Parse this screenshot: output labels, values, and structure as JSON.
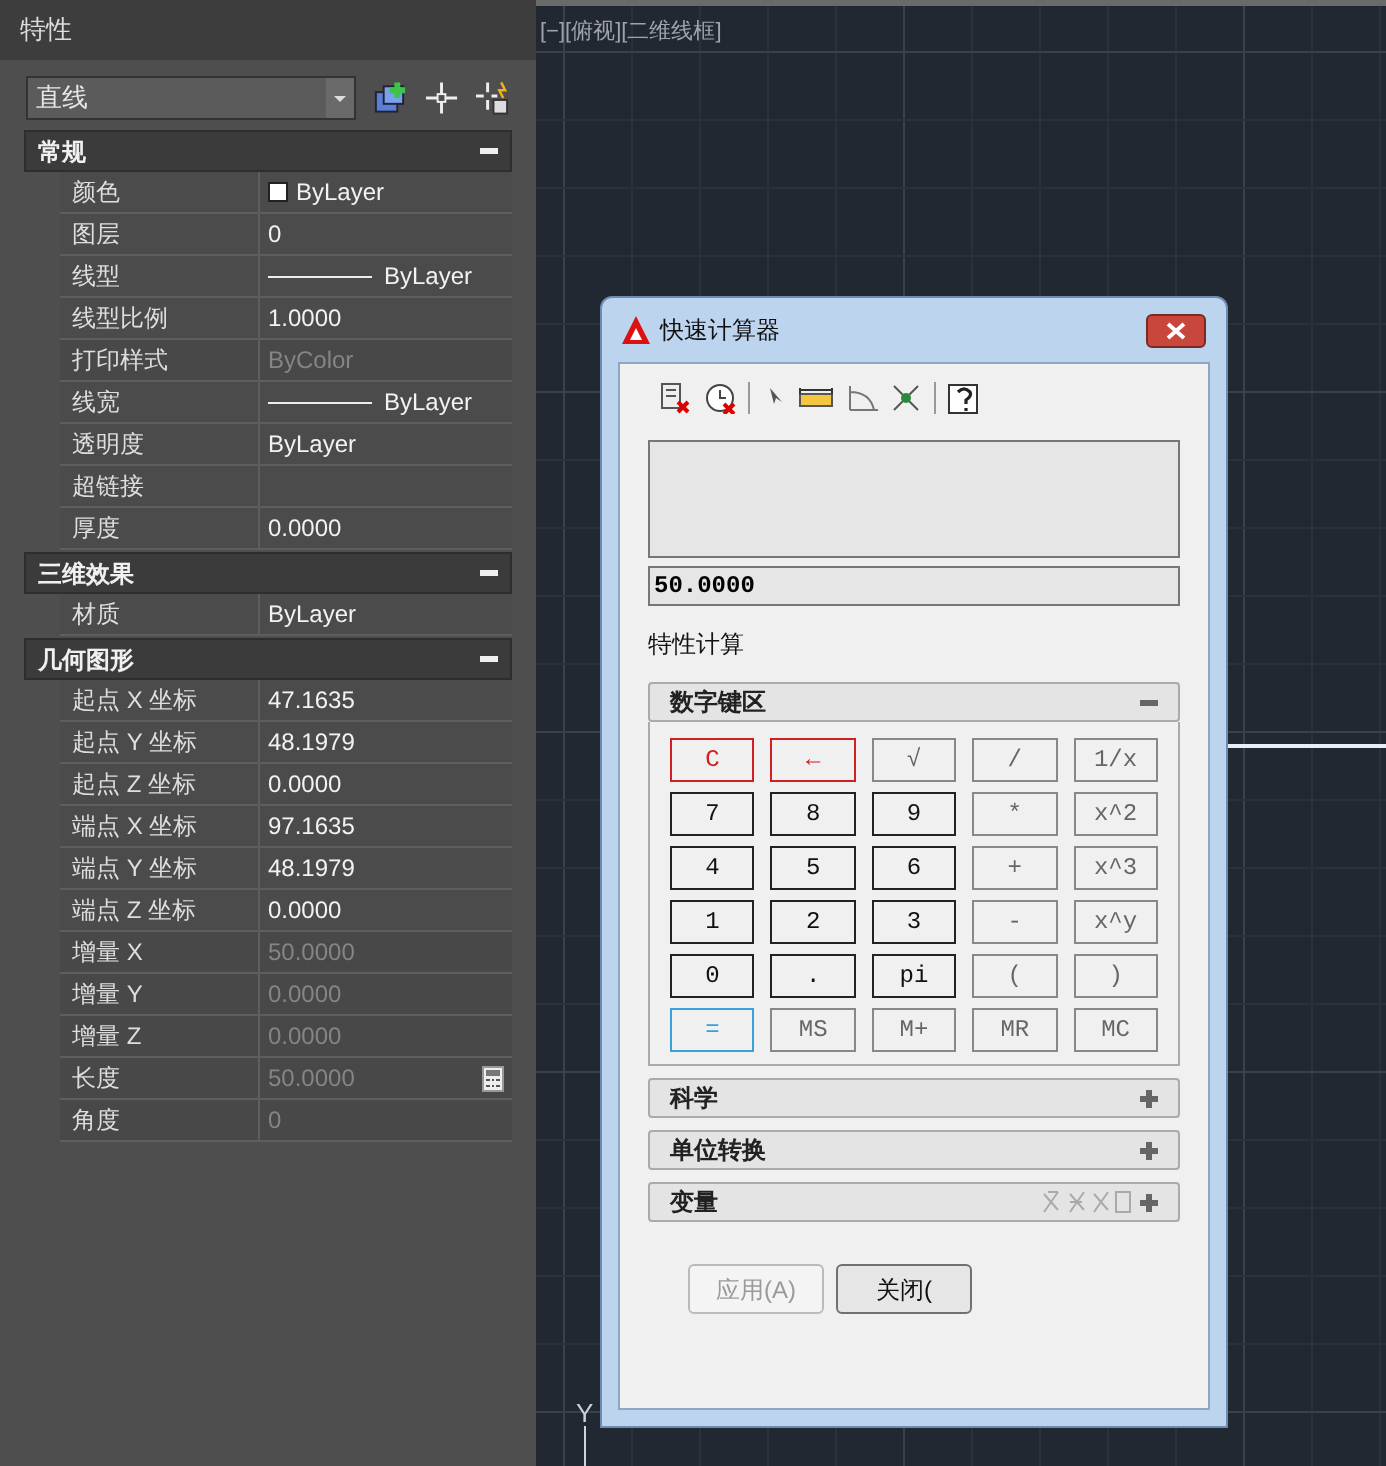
{
  "properties_panel": {
    "title": "特性",
    "object_type": "直线",
    "sections": [
      {
        "title": "常规",
        "expanded": true,
        "rows": [
          {
            "label": "颜色",
            "value": "ByLayer",
            "kind": "swatch",
            "disabled": false
          },
          {
            "label": "图层",
            "value": "0",
            "kind": "text",
            "disabled": false
          },
          {
            "label": "线型",
            "value": "ByLayer",
            "kind": "line",
            "disabled": false
          },
          {
            "label": "线型比例",
            "value": "1.0000",
            "kind": "text",
            "disabled": false
          },
          {
            "label": "打印样式",
            "value": "ByColor",
            "kind": "text",
            "disabled": true
          },
          {
            "label": "线宽",
            "value": "ByLayer",
            "kind": "line",
            "disabled": false
          },
          {
            "label": "透明度",
            "value": "ByLayer",
            "kind": "text",
            "disabled": false
          },
          {
            "label": "超链接",
            "kind": "text"
          },
          {
            "label": "厚度",
            "value": "0.0000",
            "kind": "text",
            "disabled": false
          }
        ]
      },
      {
        "title": "三维效果",
        "expanded": true,
        "rows": [
          {
            "label": "材质",
            "value": "ByLayer",
            "kind": "text",
            "disabled": false
          }
        ]
      },
      {
        "title": "几何图形",
        "expanded": true,
        "rows": [
          {
            "label": "起点 X 坐标",
            "value": "47.1635",
            "kind": "text",
            "disabled": false
          },
          {
            "label": "起点 Y 坐标",
            "value": "48.1979",
            "kind": "text",
            "disabled": false
          },
          {
            "label": "起点 Z 坐标",
            "value": "0.0000",
            "kind": "text",
            "disabled": false
          },
          {
            "label": "端点 X 坐标",
            "value": "97.1635",
            "kind": "text",
            "disabled": false
          },
          {
            "label": "端点 Y 坐标",
            "value": "48.1979",
            "kind": "text",
            "disabled": false
          },
          {
            "label": "端点 Z 坐标",
            "value": "0.0000",
            "kind": "text",
            "disabled": false
          },
          {
            "label": "增量 X",
            "value": "50.0000",
            "kind": "text",
            "disabled": true
          },
          {
            "label": "增量 Y",
            "value": "0.0000",
            "kind": "text",
            "disabled": true
          },
          {
            "label": "增量 Z",
            "value": "0.0000",
            "kind": "text",
            "disabled": true
          },
          {
            "label": "长度",
            "value": "50.0000",
            "kind": "calc",
            "disabled": true
          },
          {
            "label": "角度",
            "value": "0",
            "kind": "text",
            "disabled": true
          }
        ]
      }
    ]
  },
  "viewport": {
    "label": "[−][俯视][二维线框]",
    "axis_label": "Y"
  },
  "calculator": {
    "title": "快速计算器",
    "input": "50.0000",
    "mode_label": "特性计算",
    "keypad": {
      "title": "数字键区",
      "expanded": true,
      "keys": [
        {
          "label": "C",
          "kind": "clear"
        },
        {
          "label": "←",
          "kind": "clear"
        },
        {
          "label": "√",
          "kind": "op"
        },
        {
          "label": "/",
          "kind": "op"
        },
        {
          "label": "1/x",
          "kind": "op"
        },
        {
          "label": "7",
          "kind": "digit"
        },
        {
          "label": "8",
          "kind": "digit"
        },
        {
          "label": "9",
          "kind": "digit"
        },
        {
          "label": "*",
          "kind": "op"
        },
        {
          "label": "x^2",
          "kind": "op"
        },
        {
          "label": "4",
          "kind": "digit"
        },
        {
          "label": "5",
          "kind": "digit"
        },
        {
          "label": "6",
          "kind": "digit"
        },
        {
          "label": "+",
          "kind": "op"
        },
        {
          "label": "x^3",
          "kind": "op"
        },
        {
          "label": "1",
          "kind": "digit"
        },
        {
          "label": "2",
          "kind": "digit"
        },
        {
          "label": "3",
          "kind": "digit"
        },
        {
          "label": "-",
          "kind": "op"
        },
        {
          "label": "x^y",
          "kind": "op"
        },
        {
          "label": "0",
          "kind": "digit"
        },
        {
          "label": ".",
          "kind": "digit"
        },
        {
          "label": "pi",
          "kind": "digit"
        },
        {
          "label": "(",
          "kind": "op"
        },
        {
          "label": ")",
          "kind": "op"
        },
        {
          "label": "=",
          "kind": "equals"
        },
        {
          "label": "MS",
          "kind": "op"
        },
        {
          "label": "M+",
          "kind": "op"
        },
        {
          "label": "MR",
          "kind": "op"
        },
        {
          "label": "MC",
          "kind": "op"
        }
      ]
    },
    "panels": [
      {
        "title": "科学",
        "expanded": false,
        "variable_tools": false
      },
      {
        "title": "单位转换",
        "expanded": false,
        "variable_tools": false
      },
      {
        "title": "变量",
        "expanded": false,
        "variable_tools": true
      }
    ],
    "buttons": [
      {
        "label": "应用(A)",
        "disabled": true
      },
      {
        "label": "关闭(",
        "disabled": false
      }
    ]
  }
}
